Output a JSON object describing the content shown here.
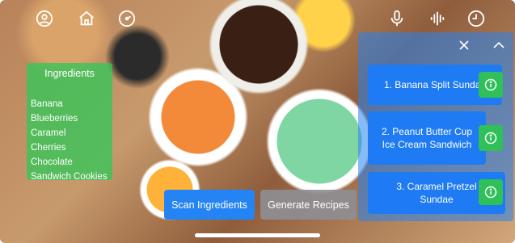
{
  "topbar": {
    "left_icons": [
      "profile-icon",
      "home-icon",
      "speedometer-icon"
    ],
    "right_icons": [
      "microphone-icon",
      "waveform-icon",
      "history-icon"
    ]
  },
  "ingredients": {
    "title": "Ingredients",
    "items": [
      "Banana",
      "Blueberries",
      "Caramel",
      "Cherries",
      "Chocolate",
      "Sandwich Cookies"
    ]
  },
  "recipes": {
    "close_icon": "close-icon",
    "collapse_icon": "chevron-up-icon",
    "items": [
      {
        "label": "1. Banana Split Sundae"
      },
      {
        "label": "2. Peanut Butter Cup Ice Cream Sandwich"
      },
      {
        "label": "3. Caramel Pretzel Sundae"
      }
    ]
  },
  "actions": {
    "scan": "Scan Ingredients",
    "generate": "Generate Recipes"
  },
  "colors": {
    "ingredients_panel": "#34c759",
    "recipe_button": "#1f7bf3",
    "info_button": "#2fc05a",
    "scan_button": "#2584f3",
    "generate_button": "#8e8e93"
  }
}
